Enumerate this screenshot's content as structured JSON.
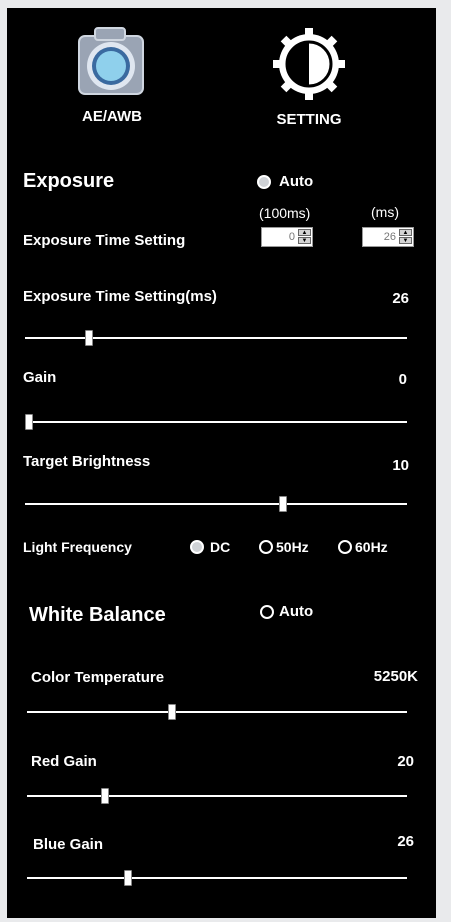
{
  "modes": [
    {
      "label": "AE/AWB",
      "icon": "camera-icon"
    },
    {
      "label": "SETTING",
      "icon": "gear-contrast-icon"
    }
  ],
  "exposure": {
    "title": "Exposure",
    "auto_label": "Auto",
    "time_setting_label": "Exposure Time Setting",
    "unit_100ms": "(100ms)",
    "unit_ms": "(ms)",
    "value_100ms": "0",
    "value_ms": "26",
    "time_ms_label": "Exposure Time Setting(ms)",
    "time_ms_value": "26",
    "time_ms_slider": 0.16,
    "gain_label": "Gain",
    "gain_value": "0",
    "gain_slider": 0.0,
    "brightness_label": "Target Brightness",
    "brightness_value": "10",
    "brightness_slider": 0.68,
    "light_freq_label": "Light Frequency",
    "light_freq_options": [
      "DC",
      "50Hz",
      "60Hz"
    ],
    "light_freq_selected": "DC"
  },
  "white_balance": {
    "title": "White Balance",
    "auto_label": "Auto",
    "color_temp_label": "Color Temperature",
    "color_temp_value": "5250K",
    "color_temp_slider": 0.38,
    "red_gain_label": "Red Gain",
    "red_gain_value": "20",
    "red_gain_slider": 0.2,
    "blue_gain_label": "Blue Gain",
    "blue_gain_value": "26",
    "blue_gain_slider": 0.26
  }
}
